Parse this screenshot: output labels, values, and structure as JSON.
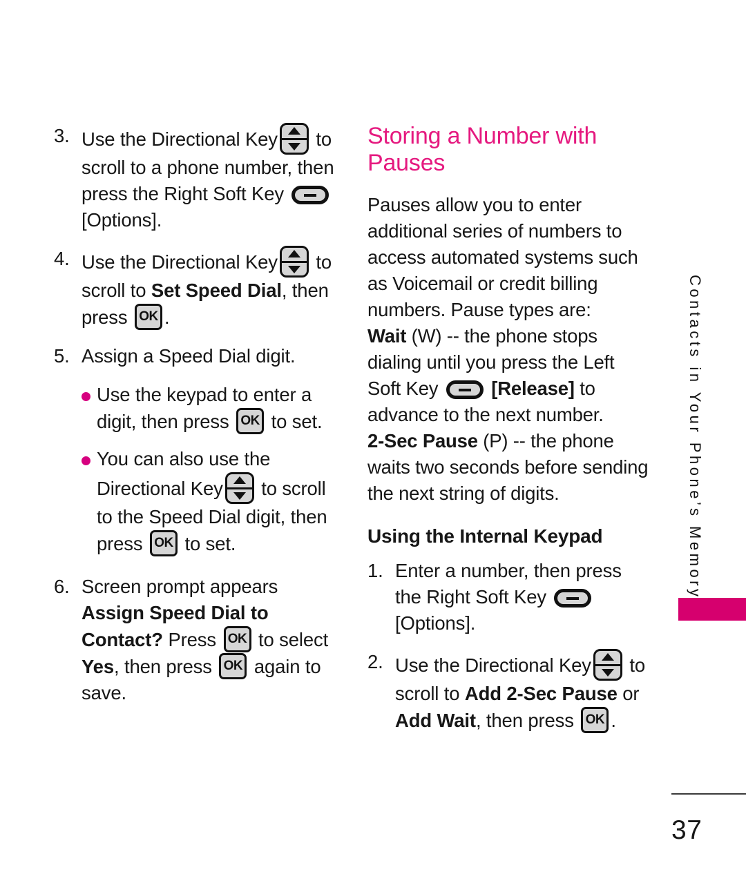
{
  "page": {
    "number": "37",
    "running_head": "Contacts in Your Phone’s Memory",
    "accent_heading_color": "#E5197F",
    "accent_tab_color": "#D6006E",
    "bullet_color": "#D6007F"
  },
  "icons": {
    "ok_label": "OK"
  },
  "left_column": {
    "steps": [
      {
        "number": "3.",
        "t1": "Use the Directional Key",
        "t2": "to scroll to a phone number, then press the Right Soft Key",
        "t3": "[Options]."
      },
      {
        "number": "4.",
        "t1": "Use the Directional Key",
        "t2": "to scroll to ",
        "bold1": "Set Speed Dial",
        "t3": ", then press",
        "t4": "."
      },
      {
        "number": "5.",
        "t1": "Assign a Speed Dial digit."
      },
      {
        "number": "6.",
        "t1": "Screen prompt appears ",
        "bold1": "Assign Speed Dial to Contact?",
        "t2": " Press",
        "t3": "to select ",
        "bold2": "Yes",
        "t4": ", then press",
        "t5": "again to save."
      }
    ],
    "bullets": [
      {
        "t1": "Use the keypad to enter a digit, then press",
        "t2": "to set."
      },
      {
        "t1": "You can also use the Directional Key",
        "t2": "to scroll to the Speed Dial digit, then press",
        "t3": "to set."
      }
    ]
  },
  "right_column": {
    "title": "Storing a Number with Pauses",
    "intro": "Pauses allow you to enter additional series of numbers to access automated systems such as Voicemail or credit billing numbers. Pause types are:",
    "wait": {
      "bold": "Wait",
      "t1": " (W) -- the phone stops dialing until you press the Left Soft Key",
      "bold2": "[Release]",
      "t2": " to advance to the next number."
    },
    "pause": {
      "bold": "2-Sec Pause",
      "t1": " (P) -- the phone waits two seconds before sending the next string of digits."
    },
    "subtitle": "Using the Internal Keypad",
    "steps": [
      {
        "number": "1.",
        "t1": "Enter a number, then press the Right Soft Key",
        "t2": "[Options]."
      },
      {
        "number": "2.",
        "t1": "Use the Directional Key",
        "t2": "to scroll to ",
        "bold1": "Add 2-Sec Pause",
        "t3": " or ",
        "bold2": "Add Wait",
        "t4": ", then press",
        "t5": "."
      }
    ]
  }
}
